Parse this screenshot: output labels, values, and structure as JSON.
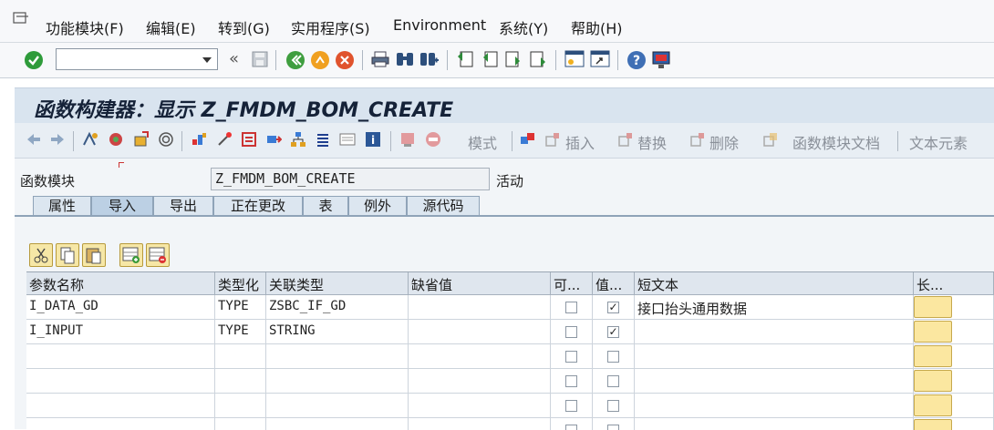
{
  "menu": {
    "items": [
      "功能模块(F)",
      "编辑(E)",
      "转到(G)",
      "实用程序(S)",
      "Environment",
      "系统(Y)",
      "帮助(H)"
    ]
  },
  "toolbar": {
    "command_field_value": "",
    "back_chevron": "«"
  },
  "title": "函数构建器：显示 Z_FMDM_BOM_CREATE",
  "app_toolbar": {
    "pattern": "模式",
    "insert": "插入",
    "replace": "替换",
    "delete": "删除",
    "fm_docs": "函数模块文档",
    "text_elements": "文本元素"
  },
  "function_module": {
    "label": "函数模块",
    "value": "Z_FMDM_BOM_CREATE",
    "status": "活动"
  },
  "tabs": [
    "属性",
    "导入",
    "导出",
    "正在更改",
    "表",
    "例外",
    "源代码"
  ],
  "active_tab": "导入",
  "grid": {
    "headers": [
      "参数名称",
      "类型化",
      "关联类型",
      "缺省值",
      "可...",
      "值...",
      "短文本",
      "长..."
    ],
    "rows": [
      {
        "name": "I_DATA_GD",
        "typing": "TYPE",
        "assoc": "ZSBC_IF_GD",
        "default": "",
        "optional": false,
        "pass_value": true,
        "short_text": "接口抬头通用数据"
      },
      {
        "name": "I_INPUT",
        "typing": "TYPE",
        "assoc": "STRING",
        "default": "",
        "optional": false,
        "pass_value": true,
        "short_text": ""
      },
      {
        "name": "",
        "typing": "",
        "assoc": "",
        "default": "",
        "optional": false,
        "pass_value": false,
        "short_text": ""
      },
      {
        "name": "",
        "typing": "",
        "assoc": "",
        "default": "",
        "optional": false,
        "pass_value": false,
        "short_text": ""
      },
      {
        "name": "",
        "typing": "",
        "assoc": "",
        "default": "",
        "optional": false,
        "pass_value": false,
        "short_text": ""
      },
      {
        "name": "",
        "typing": "",
        "assoc": "",
        "default": "",
        "optional": false,
        "pass_value": false,
        "short_text": ""
      }
    ]
  },
  "colors": {
    "accent_green": "#2e9b3a",
    "title_bg": "#d9e4ef",
    "yellow_button": "#fbe7a0"
  }
}
